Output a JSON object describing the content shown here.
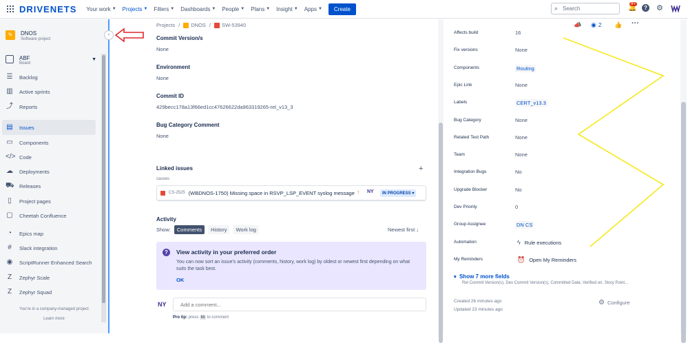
{
  "topnav": {
    "logo": "DRIVENETS",
    "items": [
      "Your work",
      "Projects",
      "Filters",
      "Dashboards",
      "People",
      "Plans",
      "Insight",
      "Apps"
    ],
    "create_label": "Create",
    "search_placeholder": "Search",
    "notifications_badge": "9+"
  },
  "sidebar": {
    "project_name": "DNOS",
    "project_type": "Software project",
    "board_name": "ABF",
    "board_type": "Board",
    "items": [
      {
        "label": "Backlog",
        "icon": "backlog-icon"
      },
      {
        "label": "Active sprints",
        "icon": "active-sprints-icon"
      },
      {
        "label": "Reports",
        "icon": "reports-icon"
      },
      {
        "label": "Issues",
        "icon": "issues-icon"
      },
      {
        "label": "Components",
        "icon": "components-icon"
      },
      {
        "label": "Code",
        "icon": "code-icon"
      },
      {
        "label": "Deployments",
        "icon": "deployments-icon"
      },
      {
        "label": "Releases",
        "icon": "releases-icon"
      },
      {
        "label": "Project pages",
        "icon": "project-pages-icon"
      },
      {
        "label": "Cheetah Confluence",
        "icon": "confluence-icon"
      },
      {
        "label": "Epics map",
        "icon": "epics-map-icon"
      },
      {
        "label": "Slack integration",
        "icon": "slack-icon"
      },
      {
        "label": "ScriptRunner Enhanced Search",
        "icon": "scriptrunner-icon"
      },
      {
        "label": "Zephyr Scale",
        "icon": "zephyr-scale-icon"
      },
      {
        "label": "Zephyr Squad",
        "icon": "zephyr-squad-icon"
      }
    ],
    "active_item": "Issues",
    "footer_text": "You're in a company-managed project",
    "footer_link": "Learn more"
  },
  "breadcrumb": {
    "projects": "Projects",
    "project": "DNOS",
    "issue": "SW-53940"
  },
  "fields": [
    {
      "label": "Commit Version/s",
      "value": "None"
    },
    {
      "label": "Environment",
      "value": "None"
    },
    {
      "label": "Commit ID",
      "value": "429becc178a13f66ed1cc47626622da963319265-rel_v13_3"
    },
    {
      "label": "Bug Category Comment",
      "value": "None"
    }
  ],
  "linked_issues": {
    "title": "Linked issues",
    "relation": "causes",
    "key": "CS-2525",
    "summary": "(WBDNOS-1750) Missing space in RSVP_LSP_EVENT syslog message",
    "status": "IN PROGRESS"
  },
  "activity": {
    "title": "Activity",
    "show_label": "Show:",
    "tabs": [
      "Comments",
      "History",
      "Work log"
    ],
    "selected_tab": "Comments",
    "sort": "Newest first",
    "notice_title": "View activity in your preferred order",
    "notice_body": "You can now sort an issue's activity (comments, history, work log) by oldest or newest first depending on what suits the task best.",
    "notice_ok": "OK",
    "comment_placeholder": "Add a comment...",
    "pro_tip_prefix": "Pro tip:",
    "pro_tip_press": "press",
    "pro_tip_key": "M",
    "pro_tip_suffix": "to comment"
  },
  "right_panel": {
    "watchers": "2",
    "details": [
      {
        "label": "Affects build",
        "value": "16"
      },
      {
        "label": "Fix versions",
        "value": "None"
      },
      {
        "label": "Components",
        "value": "Routing",
        "lozenge": true
      },
      {
        "label": "Epic Link",
        "value": "None"
      },
      {
        "label": "Labels",
        "value": "CERT_v13.3",
        "lozenge": true
      },
      {
        "label": "Bug Category",
        "value": "None"
      },
      {
        "label": "Related Test Path",
        "value": "None"
      },
      {
        "label": "Team",
        "value": "None"
      },
      {
        "label": "Integration Bugs",
        "value": "No"
      },
      {
        "label": "Upgrade Blocker",
        "value": "No"
      },
      {
        "label": "Dev Priority",
        "value": "0"
      },
      {
        "label": "Group Assignee",
        "value": "DN CS",
        "lozenge": true
      },
      {
        "label": "Automation",
        "value": "Rule executions"
      },
      {
        "label": "My Reminders",
        "value": "Open My Reminders"
      }
    ],
    "show_more": "Show 7 more fields",
    "show_more_sub": "Rel Commit Version(s), Dev Commit Version(s), Committed Date, Verified on, Story Point...",
    "created": "Created 26 minutes ago",
    "updated": "Updated 23 minutes ago",
    "configure": "Configure"
  },
  "colors": {
    "brand": "#0052cc",
    "annotation_arrow": "#e0262b",
    "annotation_lines": "#f5e81a"
  }
}
